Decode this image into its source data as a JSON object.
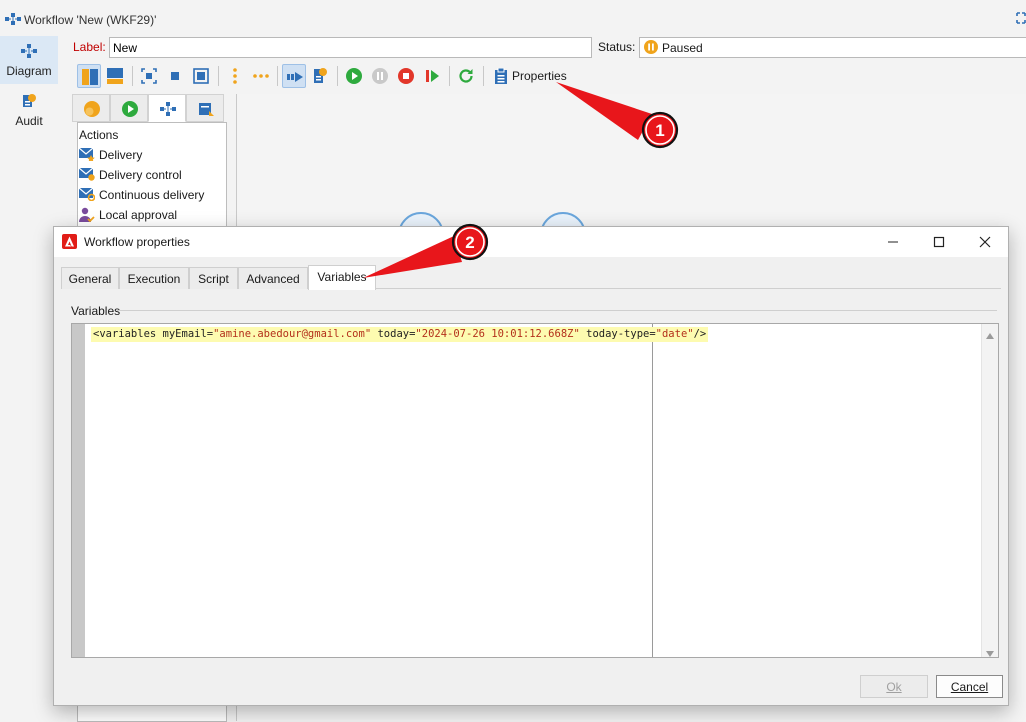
{
  "window": {
    "title": "Workflow 'New (WKF29)'"
  },
  "leftnav": {
    "items": [
      {
        "label": "Diagram",
        "icon": "diagram-icon",
        "active": true
      },
      {
        "label": "Audit",
        "icon": "audit-icon",
        "active": false
      }
    ]
  },
  "form": {
    "label_caption": "Label:",
    "label_value": "New",
    "status_caption": "Status:",
    "status_value": "Paused"
  },
  "toolbar": {
    "properties_label": "Properties",
    "icons": [
      "vertical-layout-icon",
      "horizontal-layout-icon",
      "fit-to-screen-icon",
      "stop-square-icon",
      "zoom-fit-icon",
      "vertical-dots-icon",
      "horizontal-dots-icon",
      "start-arrow-icon",
      "workflow-settings-icon",
      "play-icon",
      "pause-icon",
      "stop-icon",
      "step-icon",
      "refresh-icon",
      "properties-icon"
    ]
  },
  "palette": {
    "heading": "Actions",
    "items": [
      {
        "label": "Delivery",
        "icon": "delivery-icon"
      },
      {
        "label": "Delivery control",
        "icon": "delivery-control-icon"
      },
      {
        "label": "Continuous delivery",
        "icon": "continuous-delivery-icon"
      },
      {
        "label": "Local approval",
        "icon": "local-approval-icon"
      }
    ]
  },
  "dialog": {
    "title": "Workflow properties",
    "tabs": [
      "General",
      "Execution",
      "Script",
      "Advanced",
      "Variables"
    ],
    "selected_tab": "Variables",
    "section_label": "Variables",
    "code": {
      "p1": "<variables myEmail=",
      "v1": "\"amine.abedour@gmail.com\"",
      "p2": " today=",
      "v2": "\"2024-07-26 10:01:12.668Z\"",
      "p3": " today-type=",
      "v3": "\"date\"",
      "p4": "/>"
    },
    "ok_label": "Ok",
    "cancel_label": "Cancel"
  },
  "callouts": [
    {
      "number": "1",
      "color": "#e8161b"
    },
    {
      "number": "2",
      "color": "#e8161b"
    }
  ],
  "colors": {
    "accent": "#2f6fb6",
    "status_paused": "#f0a41c",
    "label_red": "#c00000",
    "code_highlight": "#fdfbb0",
    "code_value": "#b3301b"
  }
}
